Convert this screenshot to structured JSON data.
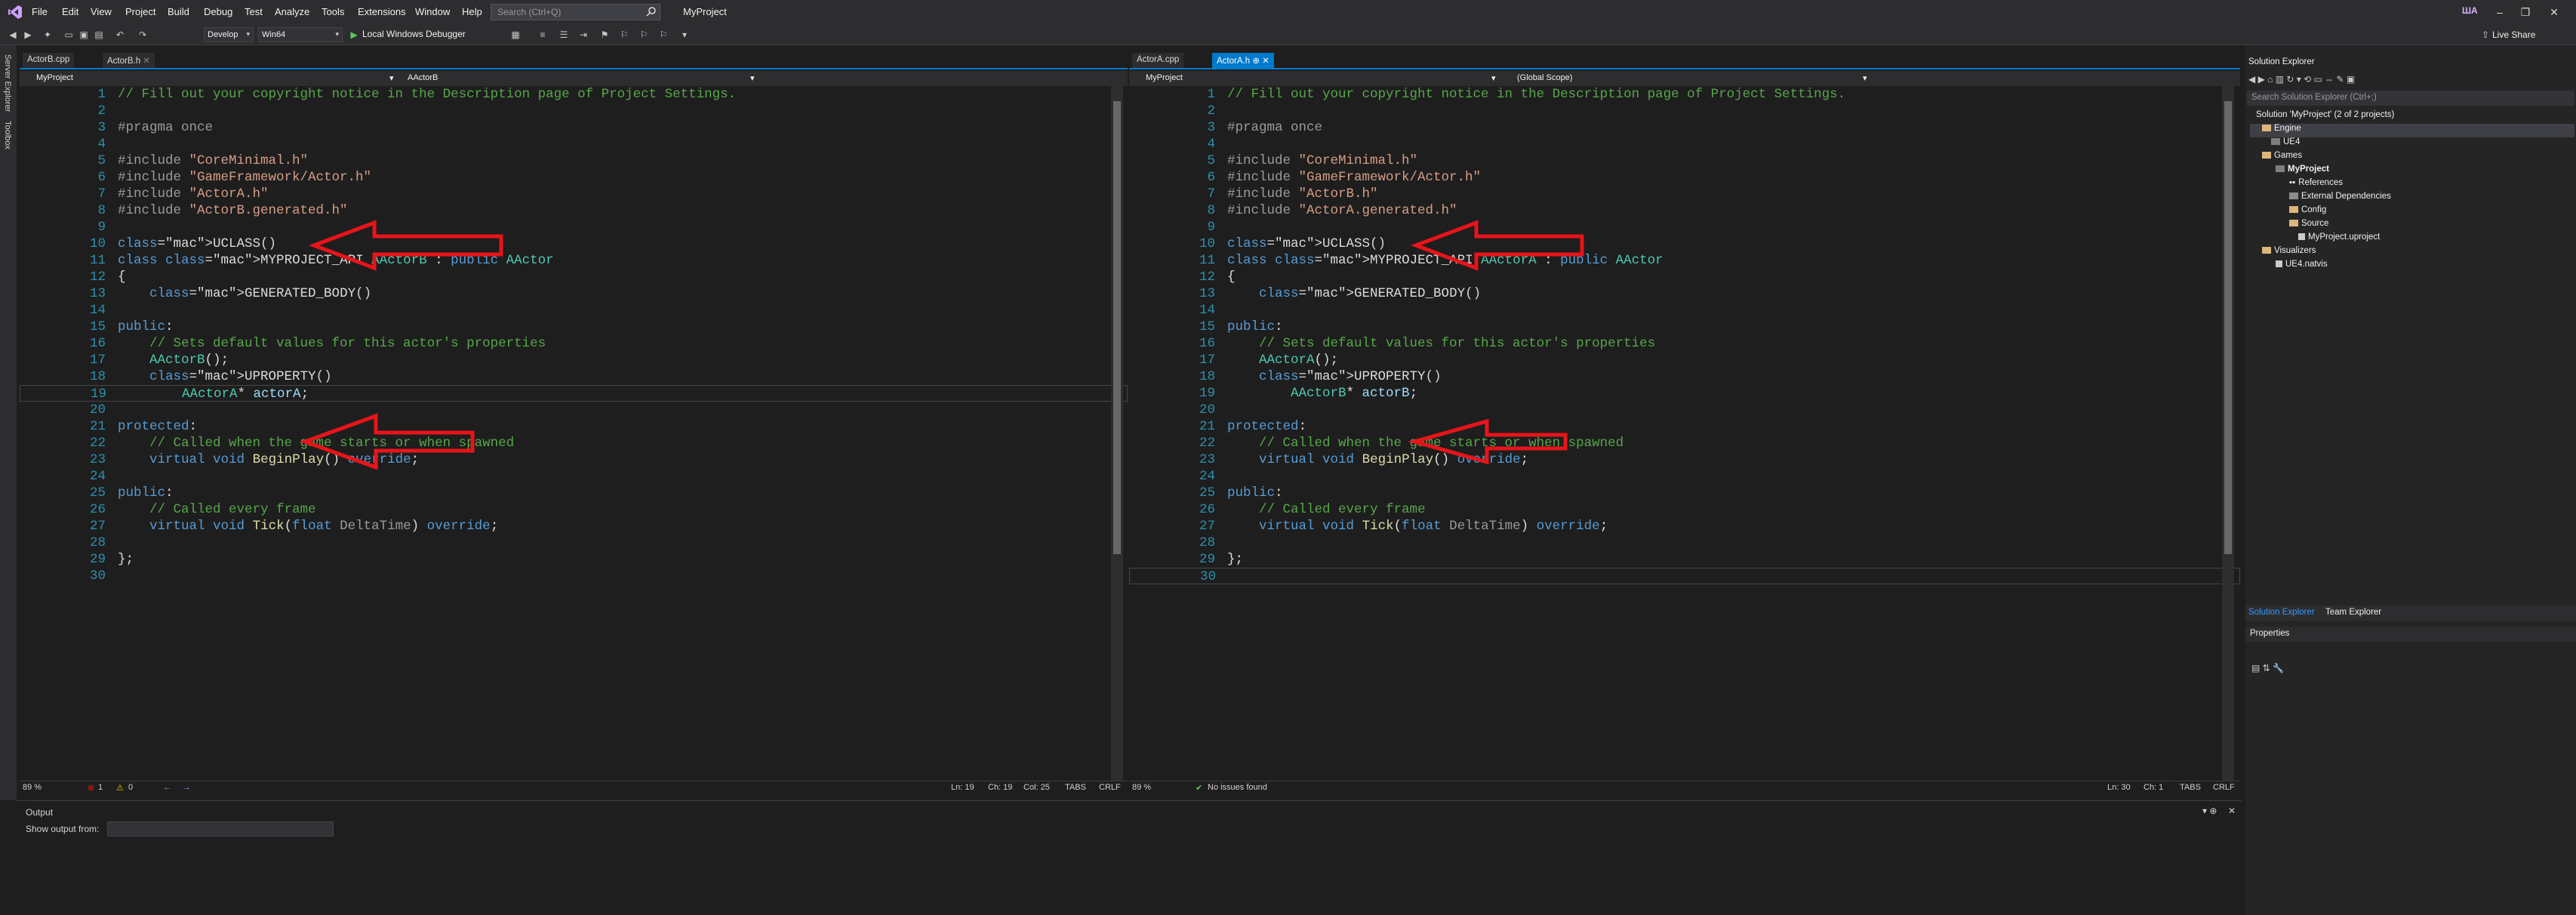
{
  "menubar": {
    "items": [
      "File",
      "Edit",
      "View",
      "Project",
      "Build",
      "Debug",
      "Test",
      "Analyze",
      "Tools",
      "Extensions",
      "Window",
      "Help"
    ],
    "search_placeholder": "Search (Ctrl+Q)",
    "project_title": "MyProject",
    "avatar": "ШA",
    "live_share": "Live Share"
  },
  "toolbar": {
    "config": "Develop",
    "platform": "Win64",
    "debugger": "Local Windows Debugger"
  },
  "left_strip": [
    "Server Explorer",
    "Toolbox"
  ],
  "left_pane": {
    "tabs": [
      "ActorB.cpp",
      "ActorB.h"
    ],
    "nav_project": "MyProject",
    "nav_scope": "AActorB",
    "zoom": "89 %",
    "errors": "1",
    "warnings": "0",
    "ln": "Ln: 19",
    "ch": "Ch: 19",
    "col": "Col: 25",
    "tabs_mode": "TABS",
    "eol": "CRLF"
  },
  "right_pane": {
    "tabs": [
      "ActorA.cpp",
      "ActorA.h"
    ],
    "nav_project": "MyProject",
    "nav_scope": "(Global Scope)",
    "zoom": "89 %",
    "issues": "No issues found",
    "ln": "Ln: 30",
    "ch": "Ch: 1",
    "tabs_mode": "TABS",
    "eol": "CRLF"
  },
  "code_left": [
    "// Fill out your copyright notice in the Description page of Project Settings.",
    "",
    "#pragma once",
    "",
    "#include \"CoreMinimal.h\"",
    "#include \"GameFramework/Actor.h\"",
    "#include \"ActorA.h\"",
    "#include \"ActorB.generated.h\"",
    "",
    "UCLASS()",
    "class MYPROJECT_API AActorB : public AActor",
    "{",
    "    GENERATED_BODY()",
    "",
    "public:",
    "    // Sets default values for this actor's properties",
    "    AActorB();",
    "    UPROPERTY()",
    "        AActorA* actorA;",
    "",
    "protected:",
    "    // Called when the game starts or when spawned",
    "    virtual void BeginPlay() override;",
    "",
    "public:",
    "    // Called every frame",
    "    virtual void Tick(float DeltaTime) override;",
    "",
    "};",
    ""
  ],
  "code_right": [
    "// Fill out your copyright notice in the Description page of Project Settings.",
    "",
    "#pragma once",
    "",
    "#include \"CoreMinimal.h\"",
    "#include \"GameFramework/Actor.h\"",
    "#include \"ActorB.h\"",
    "#include \"ActorA.generated.h\"",
    "",
    "UCLASS()",
    "class MYPROJECT_API AActorA : public AActor",
    "{",
    "    GENERATED_BODY()",
    "",
    "public:",
    "    // Sets default values for this actor's properties",
    "    AActorA();",
    "    UPROPERTY()",
    "        AActorB* actorB;",
    "",
    "protected:",
    "    // Called when the game starts or when spawned",
    "    virtual void BeginPlay() override;",
    "",
    "public:",
    "    // Called every frame",
    "    virtual void Tick(float DeltaTime) override;",
    "",
    "};",
    ""
  ],
  "output": {
    "title": "Output",
    "show_from": "Show output from:"
  },
  "solution_explorer": {
    "title": "Solution Explorer",
    "search_placeholder": "Search Solution Explorer (Ctrl+;)",
    "tree": [
      "Solution 'MyProject' (2 of 2 projects)",
      "Engine",
      "UE4",
      "Games",
      "MyProject",
      "References",
      "External Dependencies",
      "Config",
      "Source",
      "MyProject.uproject",
      "Visualizers",
      "UE4.natvis"
    ],
    "bottom_tabs": [
      "Solution Explorer",
      "Team Explorer"
    ],
    "properties": "Properties"
  },
  "accent": "#007acc",
  "arrow_color": "#e8141a"
}
